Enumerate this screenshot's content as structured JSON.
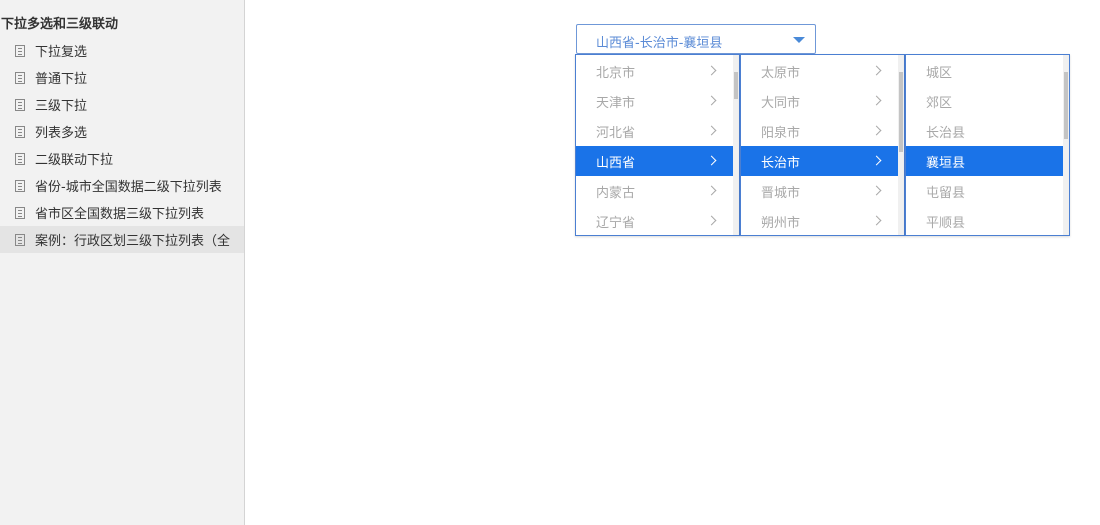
{
  "sidebar": {
    "title": "下拉多选和三级联动",
    "items": [
      {
        "label": "下拉复选",
        "icon": "document-icon",
        "active": false
      },
      {
        "label": "普通下拉",
        "icon": "document-icon",
        "active": false
      },
      {
        "label": "三级下拉",
        "icon": "document-icon",
        "active": false
      },
      {
        "label": "列表多选",
        "icon": "document-icon",
        "active": false
      },
      {
        "label": "二级联动下拉",
        "icon": "document-icon",
        "active": false
      },
      {
        "label": "省份-城市全国数据二级下拉列表",
        "icon": "document-icon",
        "active": false
      },
      {
        "label": "省市区全国数据三级下拉列表",
        "icon": "document-icon",
        "active": false
      },
      {
        "label": "案例：行政区划三级下拉列表（全",
        "icon": "document-icon",
        "active": true
      }
    ]
  },
  "cascader": {
    "value": "山西省-长治市-襄垣县",
    "caret_icon": "caret-down-icon",
    "colors": {
      "accent": "#1a73e8",
      "border": "#4b7fd2",
      "text_muted": "#a8a8a8"
    },
    "provinces": [
      {
        "label": "北京市",
        "selected": false
      },
      {
        "label": "天津市",
        "selected": false
      },
      {
        "label": "河北省",
        "selected": false
      },
      {
        "label": "山西省",
        "selected": true
      },
      {
        "label": "内蒙古",
        "selected": false
      },
      {
        "label": "辽宁省",
        "selected": false
      }
    ],
    "cities": [
      {
        "label": "太原市",
        "selected": false
      },
      {
        "label": "大同市",
        "selected": false
      },
      {
        "label": "阳泉市",
        "selected": false
      },
      {
        "label": "长治市",
        "selected": true
      },
      {
        "label": "晋城市",
        "selected": false
      },
      {
        "label": "朔州市",
        "selected": false
      }
    ],
    "counties": [
      {
        "label": "城区",
        "selected": false
      },
      {
        "label": "郊区",
        "selected": false
      },
      {
        "label": "长治县",
        "selected": false
      },
      {
        "label": "襄垣县",
        "selected": true
      },
      {
        "label": "屯留县",
        "selected": false
      },
      {
        "label": "平顺县",
        "selected": false
      }
    ]
  }
}
